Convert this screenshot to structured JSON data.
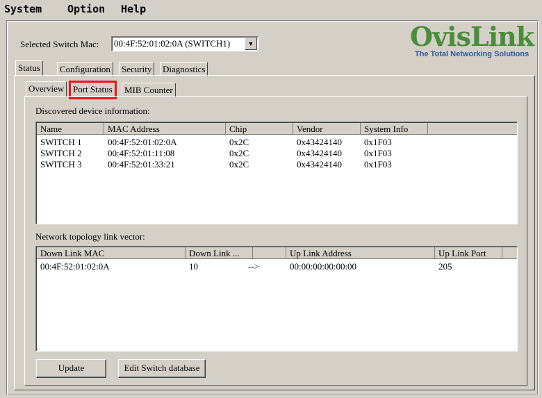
{
  "menu": {
    "items": [
      {
        "label": "System"
      },
      {
        "label": "Option"
      },
      {
        "label": "Help"
      }
    ]
  },
  "switch_select": {
    "label": "Selected Switch Mac:",
    "value": "00:4F:52:01:02:0A (SWITCH1)"
  },
  "logo": {
    "name": "OvisLink",
    "tagline": "The Total Networking Solutions"
  },
  "main_tabs": [
    "Status",
    "Configuration",
    "Security",
    "Diagnostics"
  ],
  "sub_tabs": [
    "Overview",
    "Port Status",
    "MIB Counter"
  ],
  "devices": {
    "title": "Discovered device information:",
    "columns": [
      "Name",
      "MAC Address",
      "Chip",
      "Vendor",
      "System Info"
    ],
    "rows": [
      [
        "SWITCH 1",
        "00:4F:52:01:02:0A",
        "0x2C",
        "0x43424140",
        "0x1F03"
      ],
      [
        "SWITCH 2",
        "00:4F:52:01:11:08",
        "0x2C",
        "0x43424140",
        "0x1F03"
      ],
      [
        "SWITCH 3",
        "00:4F:52:01:33:21",
        "0x2C",
        "0x43424140",
        "0x1F03"
      ]
    ]
  },
  "topology": {
    "title": "Network topology link vector:",
    "columns": [
      "Down Link MAC",
      "Down Link ...",
      "",
      "Up Link Address",
      "Up Link Port"
    ],
    "rows": [
      [
        "00:4F:52:01:02:0A",
        "10",
        "-->",
        "00:00:00:00:00:00",
        "205"
      ]
    ]
  },
  "buttons": {
    "update": "Update",
    "edit_db": "Edit Switch database"
  },
  "colors": {
    "highlight": "#e8141b",
    "logo_green": "#4a8d3a",
    "logo_blue": "#2a5aa0"
  }
}
